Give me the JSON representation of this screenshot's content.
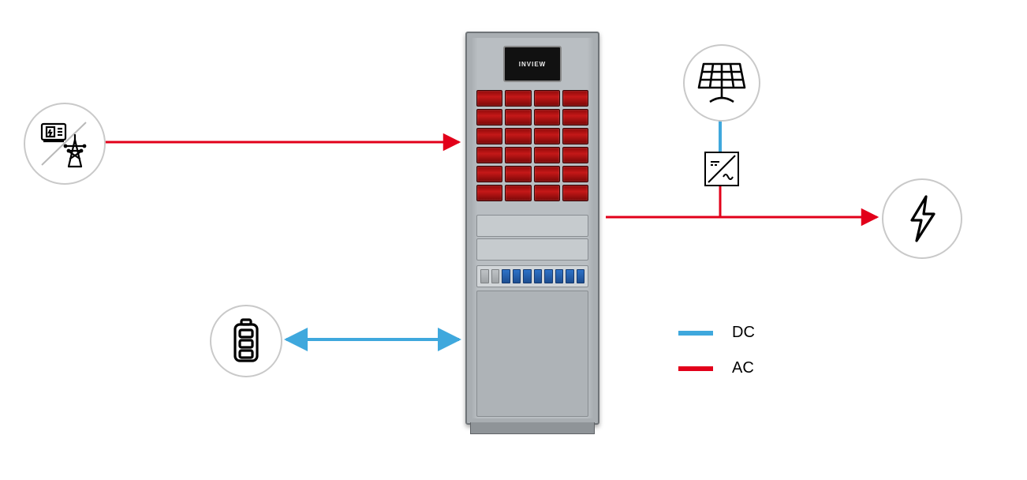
{
  "colors": {
    "ac": "#e2001a",
    "dc": "#3fa8dd",
    "node_stroke": "#c9c9c9"
  },
  "legend": {
    "dc_label": "DC",
    "ac_label": "AC"
  },
  "cabinet_display": "INVIEW",
  "nodes": {
    "grid": {
      "label": "Grid / Genset source"
    },
    "battery": {
      "label": "Battery storage"
    },
    "solar": {
      "label": "Solar PV array"
    },
    "inverter": {
      "label": "DC/AC inverter"
    },
    "load": {
      "label": "AC load"
    }
  },
  "connections": [
    {
      "from": "grid",
      "to": "cabinet",
      "type": "AC",
      "direction": "to-cabinet"
    },
    {
      "from": "battery",
      "to": "cabinet",
      "type": "DC",
      "direction": "bidirectional"
    },
    {
      "from": "solar",
      "to": "inverter",
      "type": "DC",
      "direction": "to-inverter"
    },
    {
      "from": "inverter",
      "to": "ac-bus",
      "type": "AC",
      "direction": "to-bus"
    },
    {
      "from": "cabinet",
      "to": "load",
      "type": "AC",
      "direction": "to-load"
    }
  ]
}
